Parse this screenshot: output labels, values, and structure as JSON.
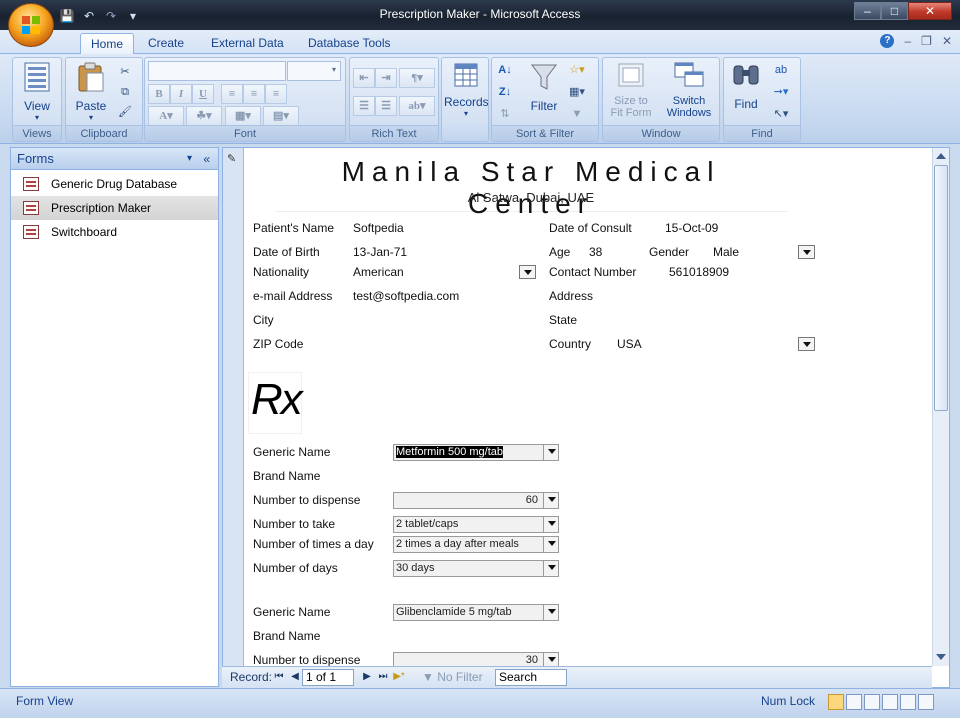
{
  "window": {
    "title": "Prescription Maker - Microsoft Access",
    "minimize": "–",
    "maximize": "□",
    "close": "✕"
  },
  "qat": [
    "save-icon",
    "undo-icon",
    "redo-icon",
    "customize-icon"
  ],
  "tabs": [
    "Home",
    "Create",
    "External Data",
    "Database Tools"
  ],
  "ribbon": {
    "views": {
      "view_label": "View",
      "group_label": "Views"
    },
    "clipboard": {
      "paste_label": "Paste",
      "group_label": "Clipboard"
    },
    "font": {
      "group_label": "Font"
    },
    "rich_text": {
      "group_label": "Rich Text"
    },
    "records": {
      "label": "Records"
    },
    "sort_filter": {
      "filter_label": "Filter",
      "group_label": "Sort & Filter"
    },
    "window": {
      "size_to_fit_label": "Size to\nFit Form",
      "switch_windows_label": "Switch\nWindows",
      "group_label": "Window"
    },
    "find": {
      "find_label": "Find",
      "group_label": "Find"
    }
  },
  "nav_pane": {
    "title": "Forms",
    "items": [
      "Generic Drug Database",
      "Prescription Maker",
      "Switchboard"
    ],
    "selected": "Prescription Maker"
  },
  "form": {
    "center_name": "Manila Star Medical Center",
    "center_location": "Al Satwa, Dubai, UAE",
    "patient_name_label": "Patient's Name",
    "patient_name": "Softpedia",
    "date_of_consult_label": "Date of Consult",
    "date_of_consult": "15-Oct-09",
    "dob_label": "Date of Birth",
    "dob": "13-Jan-71",
    "age_label": "Age",
    "age": "38",
    "gender_label": "Gender",
    "gender": "Male",
    "nationality_label": "Nationality",
    "nationality": "American",
    "contact_label": "Contact Number",
    "contact": "561018909",
    "email_label": "e-mail Address",
    "email": "test@softpedia.com",
    "address_label": "Address",
    "city_label": "City",
    "state_label": "State",
    "zip_label": "ZIP Code",
    "country_label": "Country",
    "country": "USA",
    "rx": "Rx",
    "prescriptions": [
      {
        "generic_label": "Generic Name",
        "generic": "Metformin 500 mg/tab",
        "brand_label": "Brand Name",
        "dispense_label": "Number to dispense",
        "dispense": "60",
        "take_label": "Number to take",
        "take": "2 tablet/caps",
        "times_label": "Number of times a day",
        "times": "2 times a day after meals",
        "days_label": "Number of days",
        "days": "30 days"
      },
      {
        "generic_label": "Generic Name",
        "generic": "Glibenclamide 5 mg/tab",
        "brand_label": "Brand Name",
        "dispense_label": "Number to dispense",
        "dispense": "30"
      }
    ]
  },
  "record_nav": {
    "label": "Record:",
    "position": "1 of 1",
    "filter": "No Filter",
    "search": "Search"
  },
  "status": {
    "view": "Form View",
    "num_lock": "Num Lock"
  },
  "colors": {
    "ribbon_text": "#15428b",
    "title_bar": "#1f2a3a",
    "selection": "#d4d4d4"
  }
}
